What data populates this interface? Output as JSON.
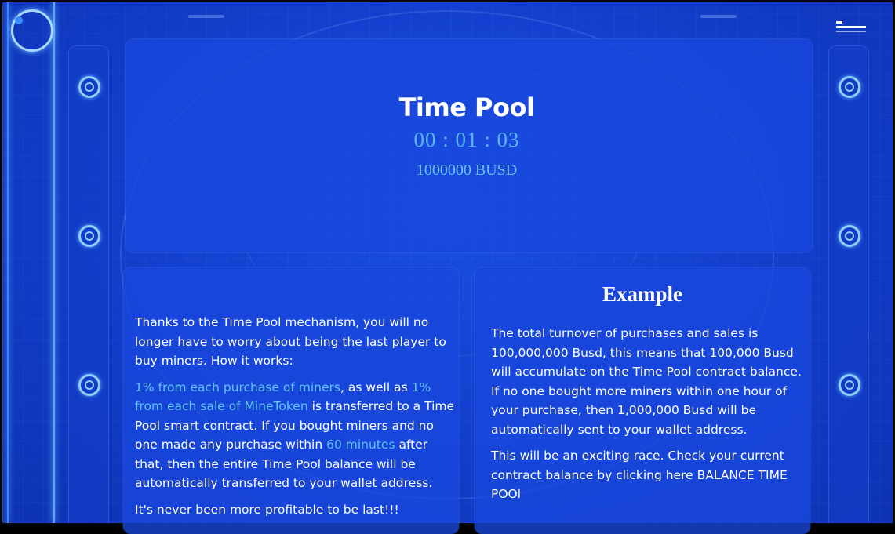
{
  "pool": {
    "title": "Time Pool",
    "timer": "00 : 01 : 03",
    "balance": "1000000 BUSD"
  },
  "info": {
    "intro": "Thanks to the Time Pool mechanism, you will no longer have to worry about being the last player to buy miners. How it works:",
    "rule": {
      "highlight_purchase": "1% from each purchase of miners",
      "text_as_well": ", as well as ",
      "highlight_sale": "1% from each sale of MineToken",
      "text_transferred": " is transferred to a Time Pool smart contract. If you bought miners and no one made any purchase within ",
      "highlight_minutes": "60 minutes",
      "text_after": " after that, then the entire Time Pool balance will be automatically transferred to your wallet address."
    },
    "closing": "It's never been more profitable to be last!!!"
  },
  "example": {
    "title": "Example",
    "paragraph1": "The total turnover of purchases and sales is 100,000,000 Busd, this means that 100,000 Busd will accumulate on the Time Pool contract balance. If no one bought more miners within one hour of your purchase, then 1,000,000 Busd will be automatically sent to your wallet address.",
    "paragraph2": "This will be an exciting race. Check your current contract balance by clicking here BALANCE TIME POOl"
  },
  "icons": {
    "logo": "circular-logo-icon",
    "menu": "hamburger-menu-icon",
    "ring": "ring-decoration-icon"
  },
  "colors": {
    "background": "#1340cf",
    "card": "#1948de",
    "accent": "#59b6f2",
    "text": "#ffffff"
  }
}
